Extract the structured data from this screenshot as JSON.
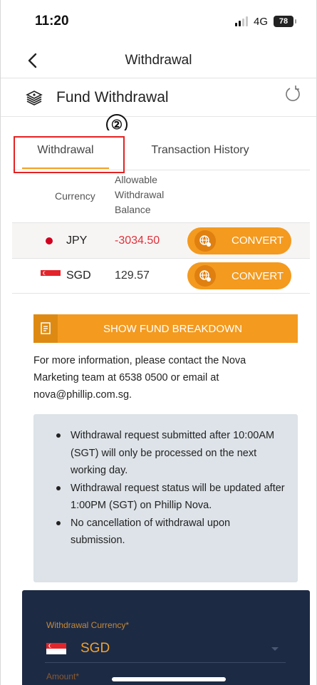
{
  "status_bar": {
    "time": "11:20",
    "network": "4G",
    "battery": "78"
  },
  "nav": {
    "title": "Withdrawal"
  },
  "header": {
    "title": "Fund Withdrawal",
    "marker": "②"
  },
  "tabs": [
    {
      "label": "Withdrawal",
      "active": true
    },
    {
      "label": "Transaction History",
      "active": false
    }
  ],
  "table": {
    "col_currency": "Currency",
    "col_balance_lines": [
      "Allowable",
      "Withdrawal",
      "Balance"
    ],
    "rows": [
      {
        "currency": "JPY",
        "balance": "-3034.50",
        "action": "CONVERT"
      },
      {
        "currency": "SGD",
        "balance": "129.57",
        "action": "CONVERT"
      }
    ]
  },
  "breakdown_button": {
    "label": "SHOW FUND BREAKDOWN"
  },
  "info_text": "For more information, please contact the Nova Marketing team at 6538 0500 or email at nova@phillip.com.sg.",
  "notices": [
    "Withdrawal request submitted after 10:00AM (SGT) will only be processed on the next working day.",
    "Withdrawal request status will be updated after 1:00PM (SGT) on Phillip Nova.",
    "No cancellation of withdrawal upon submission."
  ],
  "form": {
    "currency_label": "Withdrawal Currency*",
    "currency_value": "SGD",
    "amount_label": "Amount*"
  },
  "colors": {
    "accent": "#f39a1f",
    "negative": "#e0303a",
    "panel": "#1d2a44",
    "highlight": "#e52222"
  },
  "icons": [
    "back-icon",
    "money-stack-icon",
    "refresh-icon",
    "japan-flag-icon",
    "singapore-flag-icon",
    "globe-icon",
    "document-icon",
    "chevron-down-icon"
  ]
}
